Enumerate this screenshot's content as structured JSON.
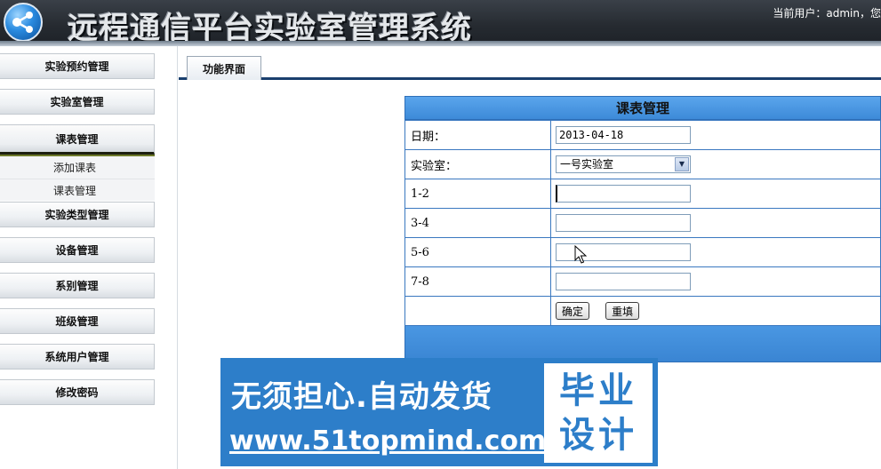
{
  "header": {
    "title": "远程通信平台实验室管理系统",
    "user_info": "当前用户：admin，您"
  },
  "sidebar": {
    "items": [
      {
        "label": "实验预约管理"
      },
      {
        "label": "实验室管理"
      },
      {
        "label": "课表管理"
      },
      {
        "label": "实验类型管理"
      },
      {
        "label": "设备管理"
      },
      {
        "label": "系别管理"
      },
      {
        "label": "班级管理"
      },
      {
        "label": "系统用户管理"
      },
      {
        "label": "修改密码"
      }
    ],
    "submenu": [
      {
        "label": "添加课表"
      },
      {
        "label": "课表管理"
      }
    ]
  },
  "tab": {
    "label": "功能界面"
  },
  "form": {
    "title": "课表管理",
    "date_label": "日期：",
    "date_value": "2013-04-18",
    "lab_label": "实验室：",
    "lab_value": "一号实验室",
    "slot1_label": "1-2",
    "slot2_label": "3-4",
    "slot3_label": "5-6",
    "slot4_label": "7-8",
    "slot1_value": "",
    "slot2_value": "",
    "slot3_value": "",
    "slot4_value": "",
    "confirm_label": "确定",
    "reset_label": "重填"
  },
  "banner": {
    "line1": "无须担心.自动发货",
    "line2": "www.51topmind.com",
    "box_top": "毕业",
    "box_bottom": "设计"
  },
  "colors": {
    "accent_blue": "#3d8ad8",
    "header_dark": "#262b31",
    "banner_blue": "#2d7ec9"
  }
}
